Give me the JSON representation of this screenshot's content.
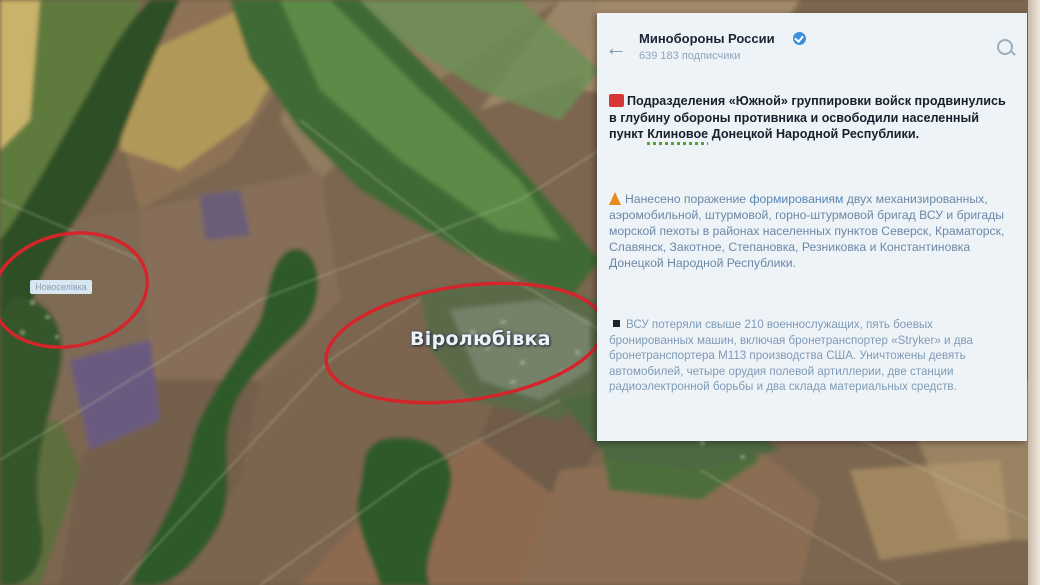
{
  "map": {
    "village_label": "Вiролюбiвка",
    "left_label": "Новоселiвка",
    "colors": {
      "field_brown": "#8a6f55",
      "forest_green": "#2f5a2a",
      "circle_red": "#d0232a"
    }
  },
  "telegram_post": {
    "channel_name": "Минобороны России",
    "subscribers": "639 183 подписчики",
    "paragraph_1": {
      "before": "Подразделения «Южной» группировки войск продвинулись в глубину обороны противника и освободили населенный пункт ",
      "place": "Клиновое",
      "after": " Донецкой Народной Республики."
    },
    "paragraph_2": {
      "before": "Нанесено поражение ",
      "link": "формированиям",
      "after": " двух механизированных, аэромобильной, штурмовой, горно-штурмовой бригад ВСУ и бригады морской пехоты в районах населенных пунктов Северск, Краматорск, Славянск, Закотное, Степановка, Резниковка и Константиновка Донецкой Народной Республики."
    },
    "paragraph_3": {
      "text": "ВСУ потеряли свыше 210 военнослужащих, пять боевых бронированных машин, включая бронетранспортер «Stryker» и два бронетранспортера М113 производства США. Уничтожены девять автомобилей, четыре орудия полевой артиллерии, две станции радиоэлектронной борьбы и два склада материальных средств."
    },
    "icons": [
      "back-arrow-icon",
      "verified-icon",
      "search-icon"
    ]
  }
}
